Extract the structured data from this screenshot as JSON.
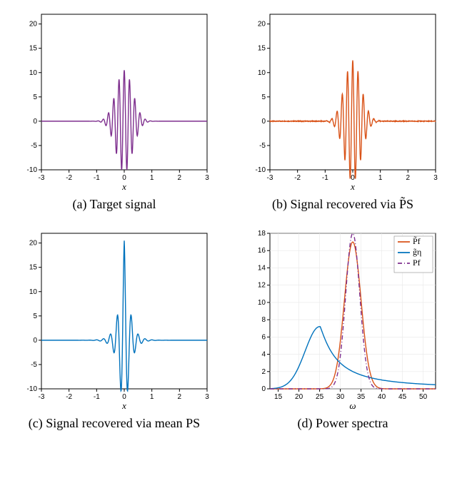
{
  "chart_data": [
    {
      "type": "line",
      "id": "a",
      "caption": "(a) Target signal",
      "xlabel": "x",
      "ylabel": "",
      "xlim": [
        -3,
        3
      ],
      "ylim": [
        -10,
        22
      ],
      "xticks": [
        -3,
        -2,
        -1,
        0,
        1,
        2,
        3
      ],
      "yticks": [
        -10,
        -5,
        0,
        5,
        10,
        15,
        20
      ],
      "series": [
        {
          "name": "target",
          "color": "#7e2f8e",
          "function": "gabor",
          "amp": 10.5,
          "sigma": 0.3,
          "omega": 33
        }
      ]
    },
    {
      "type": "line",
      "id": "b",
      "caption": "(b) Signal recovered via P̃S",
      "xlabel": "x",
      "ylabel": "",
      "xlim": [
        -3,
        3
      ],
      "ylim": [
        -10,
        22
      ],
      "xticks": [
        -3,
        -2,
        -1,
        0,
        1,
        2,
        3
      ],
      "yticks": [
        -10,
        -5,
        0,
        5,
        10,
        15,
        20
      ],
      "series": [
        {
          "name": "recovered-PS-tilde",
          "color": "#d95319",
          "function": "gabor_noisy",
          "amp": 12.5,
          "sigma": 0.3,
          "omega": 33,
          "noise": 0.15
        }
      ]
    },
    {
      "type": "line",
      "id": "c",
      "caption": "(c) Signal recovered via mean PS",
      "xlabel": "x",
      "ylabel": "",
      "xlim": [
        -3,
        3
      ],
      "ylim": [
        -10,
        22
      ],
      "xticks": [
        -3,
        -2,
        -1,
        0,
        1,
        2,
        3
      ],
      "yticks": [
        -10,
        -5,
        0,
        5,
        10,
        15,
        20
      ],
      "series": [
        {
          "name": "recovered-meanPS",
          "color": "#0072bd",
          "function": "gabor_skew",
          "amp": 20.5,
          "sigma": 0.3,
          "omega": 25
        }
      ]
    },
    {
      "type": "line",
      "id": "d",
      "caption": "(d) Power spectra",
      "xlabel": "ω",
      "ylabel": "",
      "xlim": [
        13,
        53
      ],
      "ylim": [
        0,
        18
      ],
      "xticks": [
        15,
        20,
        25,
        30,
        35,
        40,
        45,
        50
      ],
      "yticks": [
        0,
        2,
        4,
        6,
        8,
        10,
        12,
        14,
        16,
        18
      ],
      "legend_pos": "nw-inset-right",
      "series": [
        {
          "name": "P̃f",
          "label": "P̃f",
          "color": "#d95319",
          "style": "solid",
          "function": "gaussian",
          "amp": 17,
          "mu": 33.0,
          "sigma": 2.0
        },
        {
          "name": "g̃η",
          "label": "g̃η",
          "color": "#0072bd",
          "style": "solid",
          "function": "lorentzian",
          "amp": 7.2,
          "mu": 25.0,
          "sigma": 3.5
        },
        {
          "name": "Pf",
          "label": "Pf",
          "color": "#7e2f8e",
          "style": "dashdot",
          "function": "gaussian",
          "amp": 18,
          "mu": 33.0,
          "sigma": 1.7
        }
      ]
    }
  ]
}
